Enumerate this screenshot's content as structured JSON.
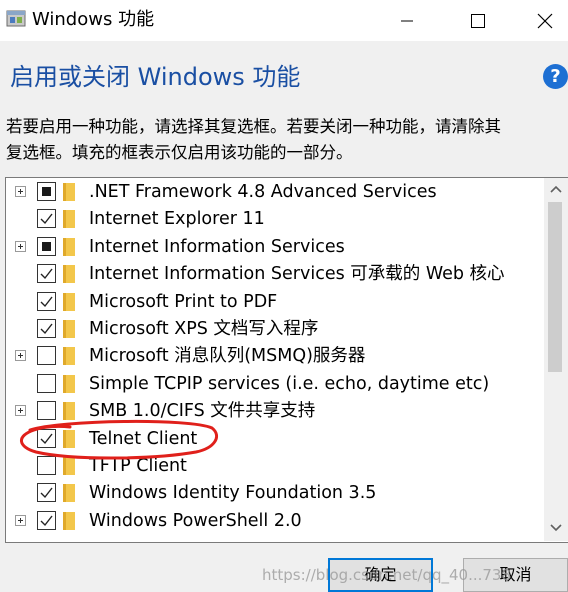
{
  "window": {
    "title": "Windows 功能",
    "icon": "windows-features-icon",
    "controls": [
      "minimize-icon",
      "maximize-icon",
      "close-icon"
    ]
  },
  "header": {
    "heading": "启用或关闭 Windows 功能",
    "help_icon": "?",
    "description_line1": "若要启用一种功能，请选择其复选框。若要关闭一种功能，请清除其",
    "description_line2": "复选框。填充的框表示仅启用该功能的一部分。"
  },
  "features": [
    {
      "label": ".NET Framework 4.8 Advanced Services",
      "state": "partial",
      "expandable": true
    },
    {
      "label": "Internet Explorer 11",
      "state": "checked",
      "expandable": false
    },
    {
      "label": "Internet Information Services",
      "state": "partial",
      "expandable": true
    },
    {
      "label": "Internet Information Services 可承载的 Web 核心",
      "state": "checked",
      "expandable": false
    },
    {
      "label": "Microsoft Print to PDF",
      "state": "checked",
      "expandable": false
    },
    {
      "label": "Microsoft XPS 文档写入程序",
      "state": "checked",
      "expandable": false
    },
    {
      "label": "Microsoft 消息队列(MSMQ)服务器",
      "state": "unchecked",
      "expandable": true
    },
    {
      "label": "Simple TCPIP services (i.e. echo, daytime etc)",
      "state": "unchecked",
      "expandable": false
    },
    {
      "label": "SMB 1.0/CIFS 文件共享支持",
      "state": "unchecked",
      "expandable": true
    },
    {
      "label": "Telnet Client",
      "state": "checked",
      "expandable": false
    },
    {
      "label": "TFTP Client",
      "state": "unchecked",
      "expandable": false
    },
    {
      "label": "Windows Identity Foundation 3.5",
      "state": "checked",
      "expandable": false
    },
    {
      "label": "Windows PowerShell 2.0",
      "state": "checked",
      "expandable": true
    }
  ],
  "colors": {
    "heading": "#1a4fa3",
    "folder": "#f3c74b",
    "annotation": "#e0201b",
    "default_button_border": "#0078d7"
  },
  "buttons": {
    "ok": "确定",
    "cancel": "取消"
  },
  "watermark": "https://blog.csdn.net/qq_40...738"
}
